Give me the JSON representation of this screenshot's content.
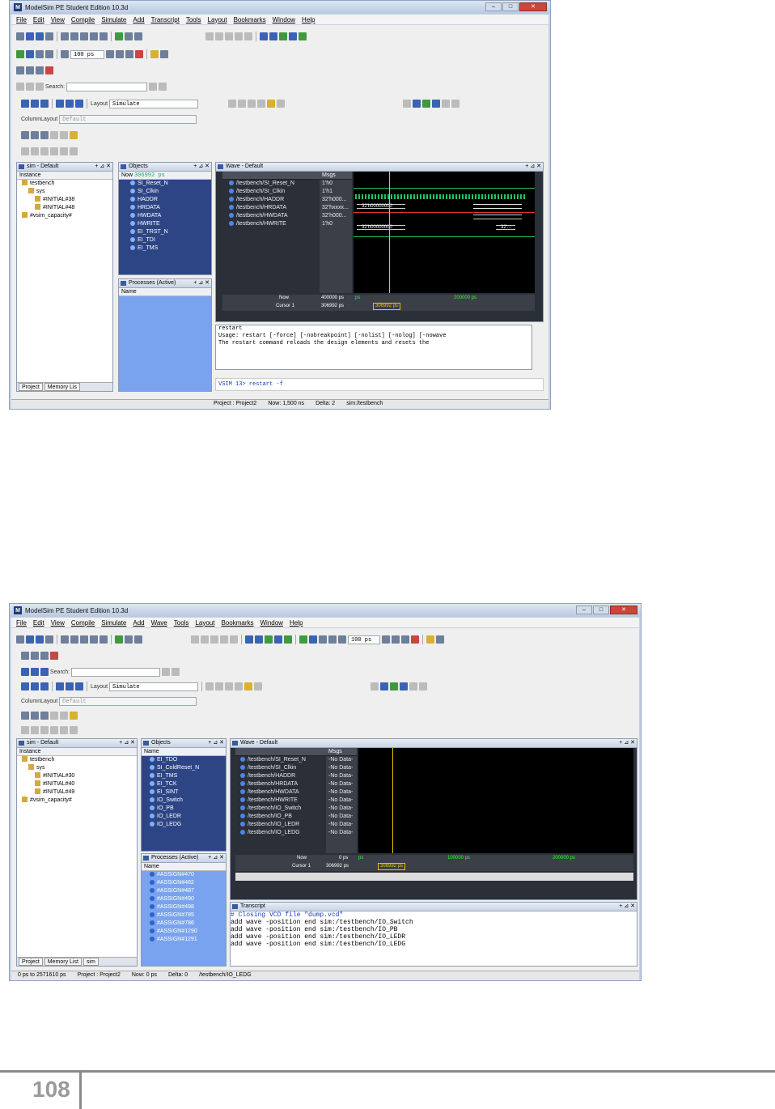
{
  "page_number": "108",
  "screenshot1": {
    "title": "ModelSim PE Student Edition 10.3d",
    "menu": [
      "File",
      "Edit",
      "View",
      "Compile",
      "Simulate",
      "Add",
      "Transcript",
      "Tools",
      "Layout",
      "Bookmarks",
      "Window",
      "Help"
    ],
    "toolbar": {
      "run_length": "100 ps",
      "search_label": "Search:",
      "layout_label": "Layout",
      "layout_value": "Simulate",
      "column_layout_label": "ColumnLayout",
      "column_layout_value": "Default"
    },
    "sim_pane": {
      "title": "sim - Default",
      "header": "Instance",
      "items": [
        "testbench",
        "sys",
        "#INITIAL#38",
        "#INITIAL#48",
        "#vsim_capacity#"
      ],
      "tabs": [
        "Project",
        "Memory Lis"
      ]
    },
    "objects_pane": {
      "title": "Objects",
      "header_now": "Now",
      "header_time": "306992 ps",
      "items": [
        "SI_Reset_N",
        "SI_Clkin",
        "HADDR",
        "HRDATA",
        "HWDATA",
        "HWRITE",
        "EI_TRST_N",
        "EI_TDI",
        "EI_TMS"
      ]
    },
    "processes_pane": {
      "title": "Processes (Active)",
      "header": "Name"
    },
    "wave_pane": {
      "title": "Wave - Default",
      "header_msgs": "Msgs",
      "signals": [
        "/testbench/SI_Reset_N",
        "/testbench/SI_Clkin",
        "/testbench/HADDR",
        "/testbench/HRDATA",
        "/testbench/HWDATA",
        "/testbench/HWRITE"
      ],
      "values": [
        "1'h0",
        "1'h1",
        "32'h000...",
        "32'hxxxx...",
        "32'h000...",
        "1'h0"
      ],
      "bus_labels": [
        "32'h00000000",
        "32'h00000000",
        "32'..."
      ],
      "now_label": "Now",
      "now_value": "400000 ps",
      "cursor_label": "Cursor 1",
      "cursor_value": "306992 ps",
      "cursor_marker": "306992 ps",
      "timeline_labels": [
        "ps",
        "200000 ps"
      ]
    },
    "transcript": {
      "lines": [
        "restart",
        "Usage: restart [-force] [-nobreakpoint] [-nolist] [-nolog] [-nowave",
        "   The restart command reloads the design elements and resets the"
      ],
      "prompt": "VSIM 13> restart -f"
    },
    "status": [
      "Project : Project2",
      "Now: 1,500 ns",
      "Delta: 2",
      "sim:/testbench"
    ]
  },
  "screenshot2": {
    "title": "ModelSim PE Student Edition 10.3d",
    "menu": [
      "File",
      "Edit",
      "View",
      "Compile",
      "Simulate",
      "Add",
      "Wave",
      "Tools",
      "Layout",
      "Bookmarks",
      "Window",
      "Help"
    ],
    "toolbar": {
      "run_length": "100 ps",
      "search_label": "Search:",
      "layout_label": "Layout",
      "layout_value": "Simulate",
      "column_layout_label": "ColumnLayout",
      "column_layout_value": "Default"
    },
    "sim_pane": {
      "title": "sim - Default",
      "header": "Instance",
      "items": [
        "testbench",
        "sys",
        "#INITIAL#30",
        "#INITIAL#40",
        "#INITIAL#49",
        "#vsim_capacity#"
      ],
      "tabs": [
        "Project",
        "Memory List",
        "sim"
      ]
    },
    "objects_pane": {
      "title": "Objects",
      "header": "Name",
      "items": [
        "EI_TDO",
        "SI_ColdReset_N",
        "EI_TMS",
        "EI_TCK",
        "EI_SINT",
        "IO_Switch",
        "IO_PB",
        "IO_LEDR",
        "IO_LEDG"
      ]
    },
    "processes_pane": {
      "title": "Processes (Active)",
      "header": "Name",
      "items": [
        "#ASSIGN#470",
        "#ASSIGN#482",
        "#ASSIGN#487",
        "#ASSIGN#490",
        "#ASSIGN#498",
        "#ASSIGN#785",
        "#ASSIGN#786",
        "#ASSIGN#1290",
        "#ASSIGN#1291"
      ]
    },
    "wave_pane": {
      "title": "Wave - Default",
      "header_msgs": "Msgs",
      "signals": [
        "/testbench/SI_Reset_N",
        "/testbench/SI_Clkin",
        "/testbench/HADDR",
        "/testbench/HRDATA",
        "/testbench/HWDATA",
        "/testbench/HWRITE",
        "/testbench/IO_Switch",
        "/testbench/IO_PB",
        "/testbench/IO_LEDR",
        "/testbench/IO_LEDG"
      ],
      "values": [
        "-No Data-",
        "-No Data-",
        "-No Data-",
        "-No Data-",
        "-No Data-",
        "-No Data-",
        "-No Data-",
        "-No Data-",
        "-No Data-",
        "-No Data-"
      ],
      "now_label": "Now",
      "now_value": "0 ps",
      "cursor_label": "Cursor 1",
      "cursor_value": "306992 ps",
      "cursor_marker": "306992 ps",
      "timeline_labels": [
        "ps",
        "100000 ps",
        "200000 ps"
      ]
    },
    "transcript": {
      "title": "Transcript",
      "lines": [
        "# Closing VCD file \"dump.vcd\"",
        "add wave -position end  sim:/testbench/IO_Switch",
        "add wave -position end  sim:/testbench/IO_PB",
        "add wave -position end  sim:/testbench/IO_LEDR",
        "add wave -position end  sim:/testbench/IO_LEDG"
      ]
    },
    "status": [
      "0 ps to 2571610 ps",
      "Project : Project2",
      "Now: 0 ps",
      "Delta: 0",
      "/testbench/IO_LEDG"
    ]
  }
}
